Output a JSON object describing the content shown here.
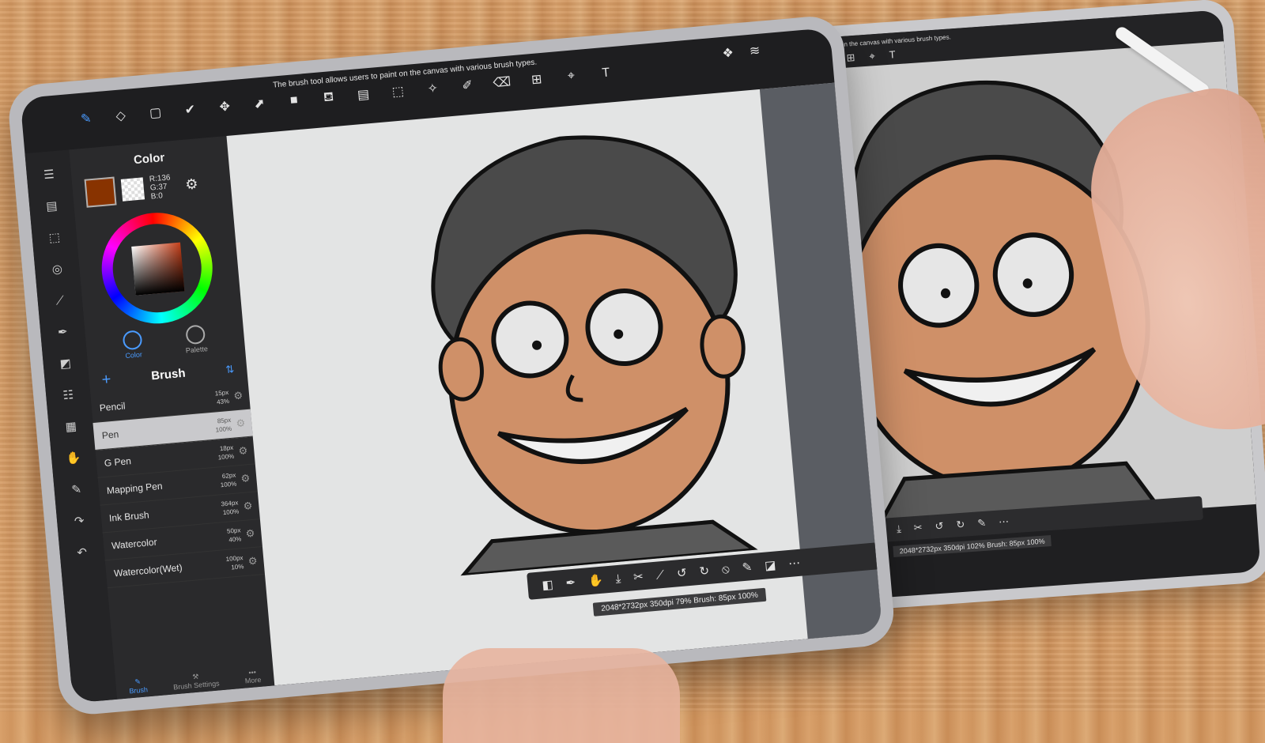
{
  "hint": "The brush tool allows users to paint on the canvas with various brush types.",
  "top_tools": [
    {
      "name": "brush-tool",
      "icon": "✎",
      "active": true
    },
    {
      "name": "eraser-tool",
      "icon": "◇"
    },
    {
      "name": "select-rect-tool",
      "icon": "▢"
    },
    {
      "name": "check-tool",
      "icon": "✔"
    },
    {
      "name": "move-tool",
      "icon": "✥"
    },
    {
      "name": "transform-tool",
      "icon": "⬈"
    },
    {
      "name": "fill-color-tool",
      "icon": "■"
    },
    {
      "name": "bucket-tool",
      "icon": "⛾"
    },
    {
      "name": "gradient-tool",
      "icon": "▤"
    },
    {
      "name": "select-marquee-tool",
      "icon": "⬚"
    },
    {
      "name": "magic-wand-tool",
      "icon": "✧"
    },
    {
      "name": "select-pen-tool",
      "icon": "✐"
    },
    {
      "name": "select-eraser-tool",
      "icon": "⌫"
    },
    {
      "name": "frame-tool",
      "icon": "⊞"
    },
    {
      "name": "lasso-select-tool",
      "icon": "⌖"
    },
    {
      "name": "text-tool",
      "icon": "T"
    }
  ],
  "color_panel": {
    "title": "Color",
    "r": "R:136",
    "g": "G:37",
    "b": "B:0",
    "main_color": "#883300",
    "tabs": [
      {
        "label": "Color",
        "active": true
      },
      {
        "label": "Palette",
        "active": false
      }
    ]
  },
  "brush_panel": {
    "title": "Brush",
    "items": [
      {
        "name": "Pencil",
        "size": "15px",
        "opacity": "43%",
        "selected": false
      },
      {
        "name": "Pen",
        "size": "85px",
        "opacity": "100%",
        "selected": true
      },
      {
        "name": "G Pen",
        "size": "18px",
        "opacity": "100%",
        "selected": false
      },
      {
        "name": "Mapping Pen",
        "size": "62px",
        "opacity": "100%",
        "selected": false
      },
      {
        "name": "Ink Brush",
        "size": "364px",
        "opacity": "100%",
        "selected": false
      },
      {
        "name": "Watercolor",
        "size": "50px",
        "opacity": "40%",
        "selected": false
      },
      {
        "name": "Watercolor(Wet)",
        "size": "100px",
        "opacity": "10%",
        "selected": false
      }
    ],
    "tabs": [
      {
        "label": "Brush",
        "active": true
      },
      {
        "label": "Brush Settings",
        "active": false
      },
      {
        "label": "More",
        "active": false
      }
    ]
  },
  "status": "2048*2732px 350dpi 79% Brush: 85px 100%",
  "status_back": "2048*2732px 350dpi 102% Brush: 85px 100%",
  "accent_color": "#4a9bff"
}
